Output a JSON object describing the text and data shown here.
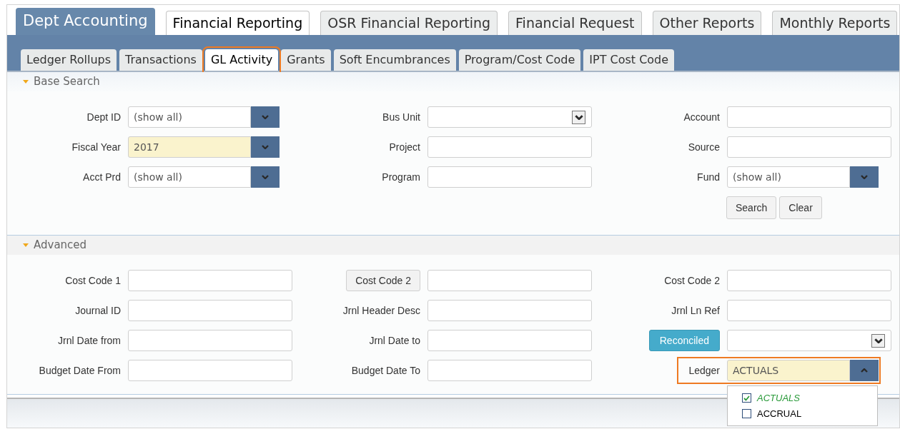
{
  "tabs": [
    {
      "label": "Dept Accounting",
      "selected": true
    },
    {
      "label": "Financial Reporting",
      "selected": false
    },
    {
      "label": "OSR Financial Reporting",
      "selected": false
    },
    {
      "label": "Financial Request",
      "selected": false
    },
    {
      "label": "Other Reports",
      "selected": false
    },
    {
      "label": "Monthly Reports",
      "selected": false
    }
  ],
  "subtabs": [
    {
      "label": "Ledger Rollups",
      "selected": false,
      "highlighted": false
    },
    {
      "label": "Transactions",
      "selected": false,
      "highlighted": false
    },
    {
      "label": "GL Activity",
      "selected": true,
      "highlighted": true
    },
    {
      "label": "Grants",
      "selected": false,
      "highlighted": false
    },
    {
      "label": "Soft Encumbrances",
      "selected": false,
      "highlighted": false
    },
    {
      "label": "Program/Cost Code",
      "selected": false,
      "highlighted": false
    },
    {
      "label": "IPT Cost Code",
      "selected": false,
      "highlighted": false
    }
  ],
  "sections": [
    {
      "title": "Base Search",
      "expanded": true,
      "rows": [
        [
          {
            "label": "Dept ID",
            "kind": "label",
            "field": {
              "kind": "dropdown",
              "value": "(show all)",
              "modified": false
            }
          },
          {
            "label": "Bus Unit",
            "kind": "label",
            "field": {
              "kind": "select"
            }
          },
          {
            "label": "Account",
            "kind": "label",
            "field": {
              "kind": "text"
            }
          }
        ],
        [
          {
            "label": "Fiscal Year",
            "kind": "label",
            "field": {
              "kind": "dropdown",
              "value": "2017",
              "modified": true
            }
          },
          {
            "label": "Project",
            "kind": "label",
            "field": {
              "kind": "text"
            }
          },
          {
            "label": "Source",
            "kind": "label",
            "field": {
              "kind": "text"
            }
          }
        ],
        [
          {
            "label": "Acct Prd",
            "kind": "label",
            "field": {
              "kind": "dropdown",
              "value": "(show all)",
              "modified": false
            }
          },
          {
            "label": "Program",
            "kind": "label",
            "field": {
              "kind": "text"
            }
          },
          {
            "label": "Fund",
            "kind": "label",
            "field": {
              "kind": "dropdown",
              "value": "(show all)",
              "modified": false
            }
          }
        ]
      ],
      "buttons": [
        "Search",
        "Clear"
      ]
    },
    {
      "title": "Advanced",
      "expanded": true,
      "rows": [
        [
          {
            "label": "Cost Code 1",
            "kind": "label",
            "field": {
              "kind": "text"
            }
          },
          {
            "label": "Cost Code 2",
            "kind": "button",
            "field": {
              "kind": "text"
            }
          },
          {
            "label": "Cost Code 2",
            "kind": "label",
            "field": {
              "kind": "text"
            }
          }
        ],
        [
          {
            "label": "Journal ID",
            "kind": "label",
            "field": {
              "kind": "text"
            }
          },
          {
            "label": "Jrnl Header Desc",
            "kind": "label",
            "field": {
              "kind": "text"
            }
          },
          {
            "label": "Jrnl Ln Ref",
            "kind": "label",
            "field": {
              "kind": "text"
            }
          }
        ],
        [
          {
            "label": "Jrnl Date from",
            "kind": "label",
            "field": {
              "kind": "text"
            }
          },
          {
            "label": "Jrnl Date to",
            "kind": "label",
            "field": {
              "kind": "text"
            }
          },
          {
            "label": "Reconciled",
            "kind": "primary_button",
            "field": {
              "kind": "select"
            }
          }
        ],
        [
          {
            "label": "Budget Date From",
            "kind": "label",
            "field": {
              "kind": "text"
            }
          },
          {
            "label": "Budget Date To",
            "kind": "label",
            "field": {
              "kind": "text"
            }
          },
          {
            "label": "Ledger",
            "kind": "label",
            "highlighted": true,
            "field": {
              "kind": "dropdown",
              "value": "ACTUALS",
              "modified": true,
              "expanded": true,
              "options": [
                {
                  "label": "ACTUALS",
                  "checked": true
                },
                {
                  "label": "ACCRUAL",
                  "checked": false
                }
              ]
            }
          }
        ]
      ]
    }
  ]
}
